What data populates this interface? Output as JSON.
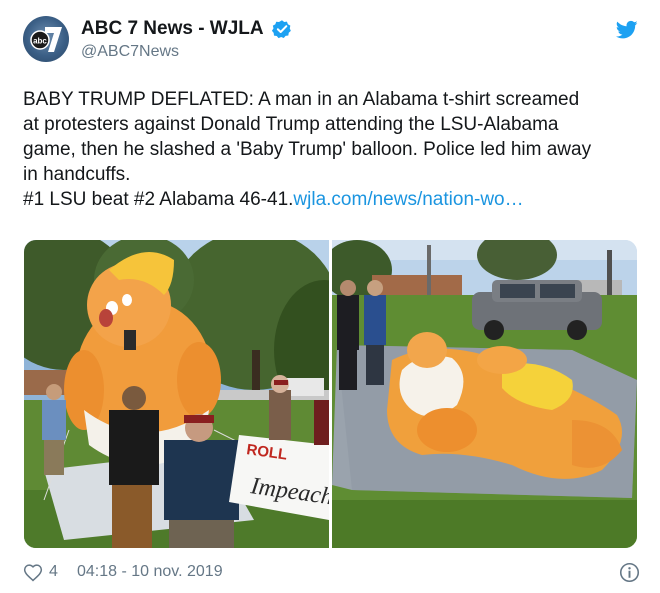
{
  "account": {
    "display_name": "ABC 7 News - WJLA",
    "handle": "@ABC7News",
    "avatar_icon": "abc7-logo-icon",
    "verified_icon": "verified-badge-icon"
  },
  "header": {
    "platform_icon": "twitter-bird-icon",
    "platform_color": "#1da1f2"
  },
  "tweet": {
    "lines": [
      "BABY TRUMP DEFLATED: A man in an Alabama t-shirt screamed",
      "at protesters against Donald Trump attending the LSU-Alabama",
      "game, then he slashed a 'Baby Trump' balloon. Police led him away",
      "in handcuffs."
    ],
    "score_line": "#1 LSU beat #2 Alabama 46-41.",
    "link_text": "wjla.com/news/nation-wo…",
    "link_color": "#1b95e0"
  },
  "media": {
    "left_photo": {
      "sign_word_1": "ROLL",
      "sign_word_2": "Impeach"
    },
    "right_photo": {}
  },
  "footer": {
    "like_icon": "heart-icon",
    "like_count": "4",
    "timestamp": "04:18 - 10 nov. 2019",
    "info_icon": "info-icon"
  }
}
